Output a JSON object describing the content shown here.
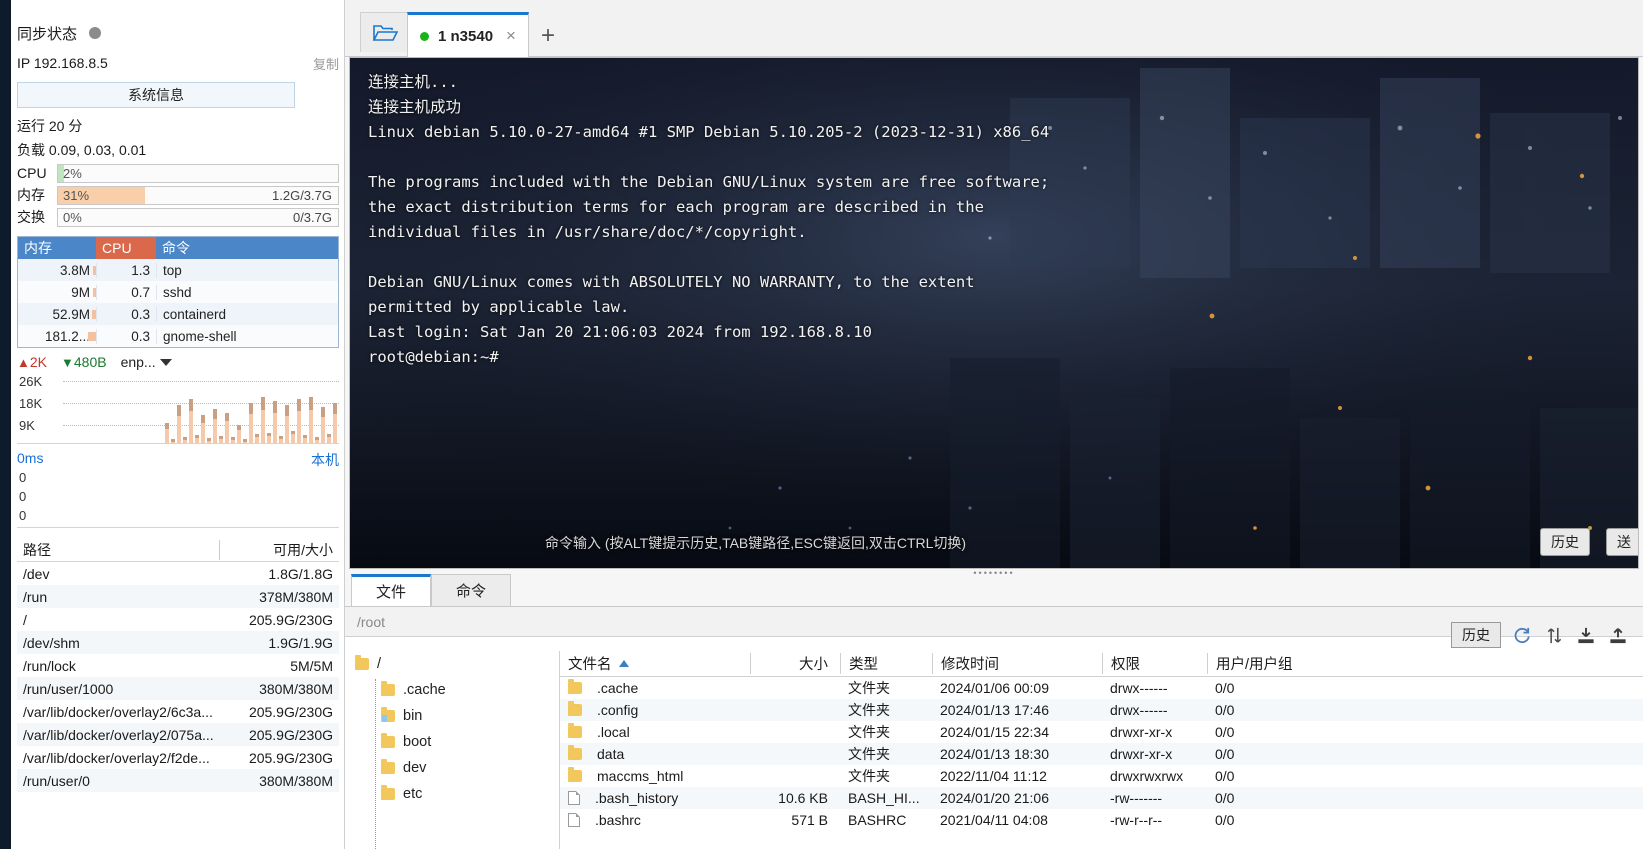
{
  "sidebar": {
    "sync_label": "同步状态",
    "ip_label": "IP 192.168.8.5",
    "copy_label": "复制",
    "sysinfo_button": "系统信息",
    "uptime": "运行 20 分",
    "load": "负载 0.09, 0.03, 0.01",
    "meters": [
      {
        "label": "CPU",
        "pct": "2%",
        "percent": 2,
        "right": "",
        "color": "#bfe6c0"
      },
      {
        "label": "内存",
        "pct": "31%",
        "percent": 31,
        "right": "1.2G/3.7G",
        "color": "#f8cfa8"
      },
      {
        "label": "交换",
        "pct": "0%",
        "percent": 0,
        "right": "0/3.7G",
        "color": "#f8cfa8"
      }
    ],
    "proc_headers": {
      "mem": "内存",
      "cpu": "CPU",
      "cmd": "命令"
    },
    "processes": [
      {
        "mem": "3.8M",
        "membar": 3,
        "cpu": "1.3",
        "cmd": "top"
      },
      {
        "mem": "9M",
        "membar": 3,
        "cpu": "0.7",
        "cmd": "sshd"
      },
      {
        "mem": "52.9M",
        "membar": 4,
        "cpu": "0.3",
        "cmd": "containerd"
      },
      {
        "mem": "181.2...",
        "membar": 8,
        "cpu": "0.3",
        "cmd": "gnome-shell"
      }
    ],
    "net": {
      "up": "2K",
      "down": "480B",
      "iface": "enp..."
    },
    "net_axis": [
      "26K",
      "18K",
      "9K"
    ],
    "ping": {
      "value": "0ms",
      "target": "本机"
    },
    "ping_axis": [
      "0",
      "0",
      "0"
    ],
    "disk_headers": {
      "path": "路径",
      "size": "可用/大小"
    },
    "disks": [
      {
        "path": "/dev",
        "size": "1.8G/1.8G"
      },
      {
        "path": "/run",
        "size": "378M/380M"
      },
      {
        "path": "/",
        "size": "205.9G/230G"
      },
      {
        "path": "/dev/shm",
        "size": "1.9G/1.9G"
      },
      {
        "path": "/run/lock",
        "size": "5M/5M"
      },
      {
        "path": "/run/user/1000",
        "size": "380M/380M"
      },
      {
        "path": "/var/lib/docker/overlay2/6c3a...",
        "size": "205.9G/230G"
      },
      {
        "path": "/var/lib/docker/overlay2/075a...",
        "size": "205.9G/230G"
      },
      {
        "path": "/var/lib/docker/overlay2/f2de...",
        "size": "205.9G/230G"
      },
      {
        "path": "/run/user/0",
        "size": "380M/380M"
      }
    ]
  },
  "tabbar": {
    "tab_label": "1 n3540",
    "close_glyph": "×",
    "plus_glyph": "+"
  },
  "terminal": {
    "lines": [
      "连接主机...",
      "连接主机成功",
      "Linux debian 5.10.0-27-amd64 #1 SMP Debian 5.10.205-2 (2023-12-31) x86_64",
      "",
      "The programs included with the Debian GNU/Linux system are free software;",
      "the exact distribution terms for each program are described in the",
      "individual files in /usr/share/doc/*/copyright.",
      "",
      "Debian GNU/Linux comes with ABSOLUTELY NO WARRANTY, to the extent",
      "permitted by applicable law.",
      "Last login: Sat Jan 20 21:06:03 2024 from 192.168.8.10",
      "root@debian:~#"
    ],
    "input_hint": "命令输入 (按ALT键提示历史,TAB键路径,ESC键返回,双击CTRL切换)",
    "history_button": "历史",
    "send_button": "送"
  },
  "bottom": {
    "tabs": [
      {
        "label": "文件",
        "active": true
      },
      {
        "label": "命令",
        "active": false
      }
    ],
    "path_value": "/root",
    "toolbar": {
      "history_label": "历史",
      "refresh_icon": "refresh-icon",
      "sort_icon": "sort-icon",
      "download_icon": "download-icon",
      "upload_icon": "upload-icon"
    },
    "tree": [
      {
        "label": "/",
        "depth": 0,
        "blue": false
      },
      {
        "label": ".cache",
        "depth": 1,
        "blue": false
      },
      {
        "label": "bin",
        "depth": 1,
        "blue": true
      },
      {
        "label": "boot",
        "depth": 1,
        "blue": false
      },
      {
        "label": "dev",
        "depth": 1,
        "blue": false
      },
      {
        "label": "etc",
        "depth": 1,
        "blue": false
      }
    ],
    "columns": [
      "文件名",
      "大小",
      "类型",
      "修改时间",
      "权限",
      "用户/用户组"
    ],
    "files": [
      {
        "name": ".cache",
        "kind": "folder",
        "size": "",
        "type": "文件夹",
        "time": "2024/01/06 00:09",
        "perm": "drwx------",
        "user": "0/0"
      },
      {
        "name": ".config",
        "kind": "folder",
        "size": "",
        "type": "文件夹",
        "time": "2024/01/13 17:46",
        "perm": "drwx------",
        "user": "0/0"
      },
      {
        "name": ".local",
        "kind": "folder",
        "size": "",
        "type": "文件夹",
        "time": "2024/01/15 22:34",
        "perm": "drwxr-xr-x",
        "user": "0/0"
      },
      {
        "name": "data",
        "kind": "folder",
        "size": "",
        "type": "文件夹",
        "time": "2024/01/13 18:30",
        "perm": "drwxr-xr-x",
        "user": "0/0"
      },
      {
        "name": "maccms_html",
        "kind": "folder",
        "size": "",
        "type": "文件夹",
        "time": "2022/11/04 11:12",
        "perm": "drwxrwxrwx",
        "user": "0/0"
      },
      {
        "name": ".bash_history",
        "kind": "file",
        "size": "10.6 KB",
        "type": "BASH_HI...",
        "time": "2024/01/20 21:06",
        "perm": "-rw-------",
        "user": "0/0"
      },
      {
        "name": ".bashrc",
        "kind": "file",
        "size": "571 B",
        "type": "BASHRC",
        "time": "2021/04/11 04:08",
        "perm": "-rw-r--r--",
        "user": "0/0"
      }
    ]
  },
  "colors": {
    "accent": "#1878d0",
    "header_blue": "#4a86c8",
    "header_red": "#d9694a",
    "mem_fill": "#f8cfa8",
    "cpu_fill": "#bfe6c0",
    "folder": "#f2c75c"
  }
}
